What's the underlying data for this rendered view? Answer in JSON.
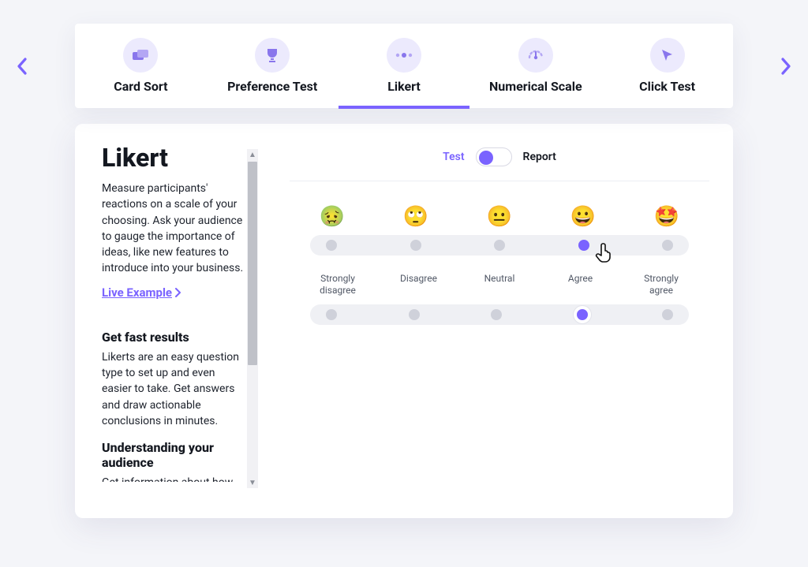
{
  "colors": {
    "accent": "#7a63ff"
  },
  "tabs": {
    "items": [
      {
        "label": "Card Sort"
      },
      {
        "label": "Preference Test"
      },
      {
        "label": "Likert"
      },
      {
        "label": "Numerical Scale"
      },
      {
        "label": "Click Test"
      }
    ],
    "active_index": 2
  },
  "side": {
    "title": "Likert",
    "desc": "Measure participants' reactions on a scale of your choosing. Ask your audience to gauge the importance of ideas, like new features to introduce into your business.",
    "live_link": "Live Example",
    "h2a": "Get fast results",
    "p2": "Likerts are an easy question type to set up and even easier to take. Get answers and draw actionable conclusions in minutes.",
    "h2b": "Understanding your audience",
    "p3": "Get information about how"
  },
  "toggle": {
    "left": "Test",
    "right": "Report",
    "state": "left"
  },
  "emoji_row": [
    "🤢",
    "🙄",
    "😐",
    "😀",
    "🤩"
  ],
  "label_row": [
    "Strongly disagree",
    "Disagree",
    "Neutral",
    "Agree",
    "Strongly agree"
  ],
  "selected_emoji_index": 3,
  "selected_label_index": 3
}
